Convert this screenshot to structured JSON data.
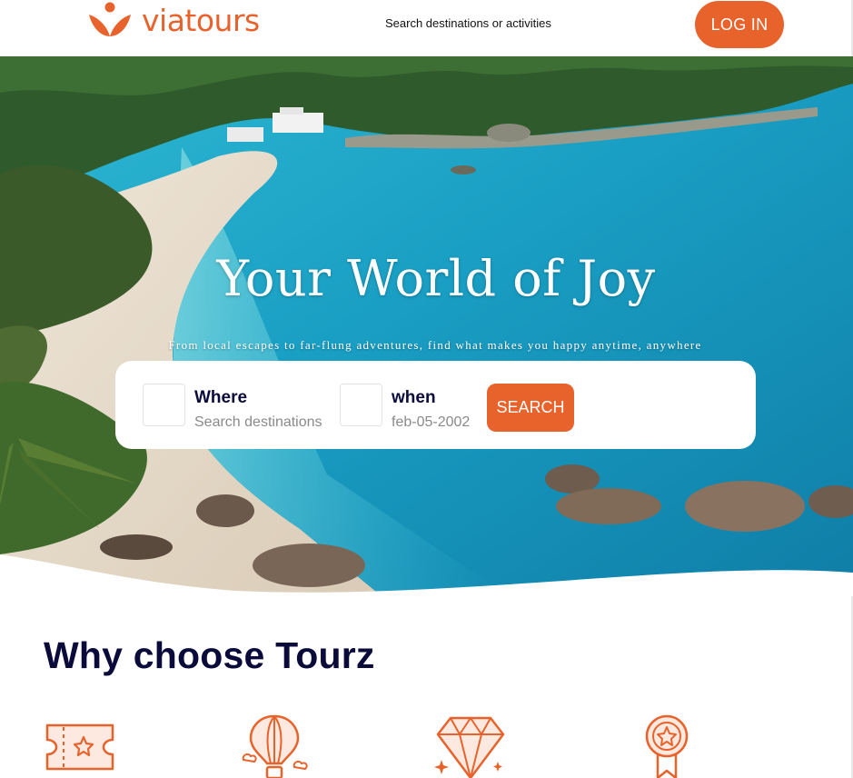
{
  "header": {
    "logo_text": "viatours",
    "search_placeholder": "Search destinations or activities",
    "login_label": "LOG IN"
  },
  "hero": {
    "title": "Your World of Joy",
    "subtitle": "From local escapes to far-flung adventures, find what makes you happy anytime, anywhere",
    "search": {
      "where_label": "Where",
      "where_placeholder": "Search destinations",
      "when_label": "when",
      "when_value": "feb-05-2002",
      "search_label": "SEARCH"
    }
  },
  "why": {
    "title": "Why choose Tourz",
    "features": [
      {
        "icon": "ticket-icon"
      },
      {
        "icon": "hot-air-balloon-icon"
      },
      {
        "icon": "diamond-icon"
      },
      {
        "icon": "award-medal-icon"
      }
    ]
  },
  "colors": {
    "accent": "#e8632c",
    "heading": "#0b0b3b",
    "sea": "#1fa9c6"
  }
}
